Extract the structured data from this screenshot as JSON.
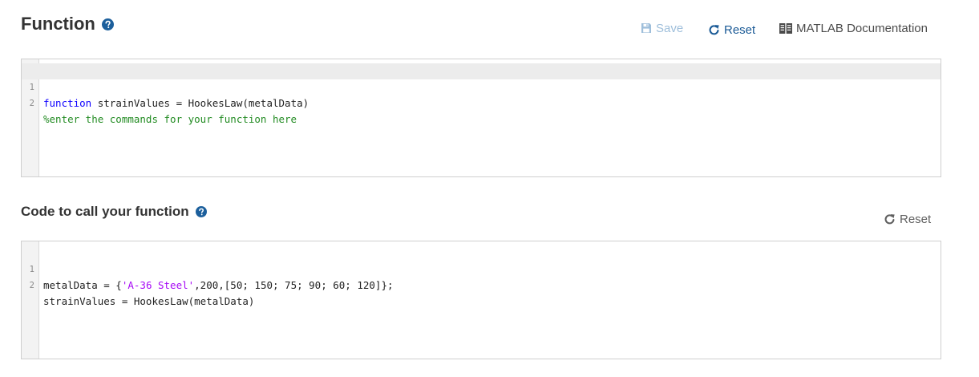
{
  "function_section": {
    "title": "Function",
    "save_label": "Save",
    "reset_label": "Reset",
    "doc_label": "MATLAB Documentation",
    "editor": {
      "lines": [
        {
          "number": "1",
          "tokens": [
            {
              "text": "function",
              "type": "keyword"
            },
            {
              "text": " strainValues = HookesLaw(metalData)",
              "type": "plain"
            }
          ]
        },
        {
          "number": "2",
          "tokens": [
            {
              "text": "%enter the commands for your function here",
              "type": "comment"
            }
          ]
        }
      ]
    }
  },
  "call_section": {
    "title": "Code to call your function",
    "reset_label": "Reset",
    "editor": {
      "lines": [
        {
          "number": "1",
          "tokens": [
            {
              "text": "metalData = {",
              "type": "plain"
            },
            {
              "text": "'A-36 Steel'",
              "type": "string"
            },
            {
              "text": ",200,[50; 150; 75; 90; 60; 120]};",
              "type": "plain"
            }
          ]
        },
        {
          "number": "2",
          "tokens": [
            {
              "text": "strainValues = HookesLaw(metalData)",
              "type": "plain"
            }
          ]
        }
      ]
    }
  },
  "icons": {
    "help": "help-circle-icon",
    "save": "floppy-disk-icon",
    "reset": "refresh-icon",
    "documentation": "book-icon"
  },
  "colors": {
    "link_blue": "#1a5a96",
    "disabled_blue": "#9fbfdb",
    "keyword": "#0e00ff",
    "comment": "#228b22",
    "string": "#a709f5",
    "help_icon": "#1c5f9c"
  }
}
